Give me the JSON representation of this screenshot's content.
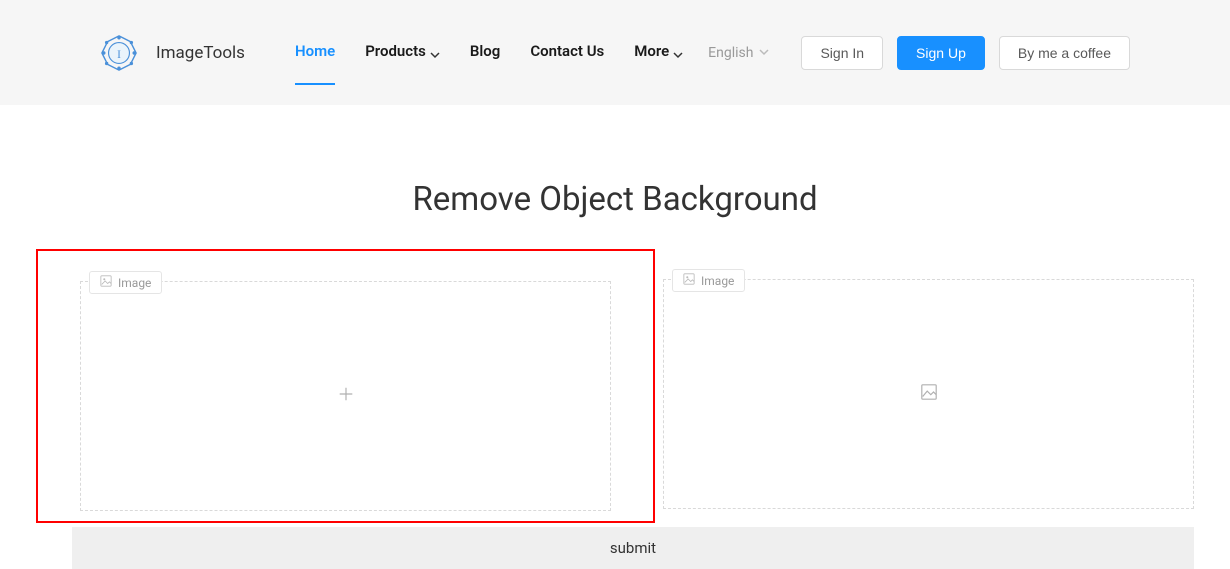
{
  "brand": {
    "name": "ImageTools"
  },
  "nav": {
    "home": "Home",
    "products": "Products",
    "blog": "Blog",
    "contact": "Contact Us",
    "more": "More"
  },
  "header": {
    "language": "English",
    "sign_in": "Sign In",
    "sign_up": "Sign Up",
    "coffee": "By me a coffee"
  },
  "page": {
    "title": "Remove Object Background"
  },
  "upload": {
    "left_label": "Image",
    "right_label": "Image"
  },
  "actions": {
    "submit": "submit"
  },
  "colors": {
    "accent": "#1890ff",
    "highlight_border": "#ff0000",
    "header_bg": "#f6f6f6"
  }
}
